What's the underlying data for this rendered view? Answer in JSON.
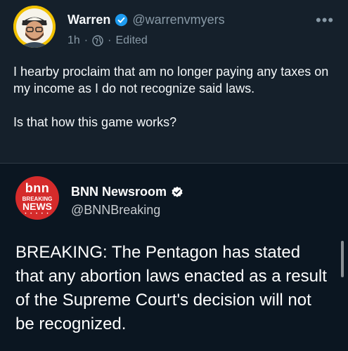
{
  "tweet": {
    "name": "Warren",
    "handle": "@warrenvmyers",
    "time": "1h",
    "separator": "·",
    "edited": "Edited",
    "lines": [
      "I hearby proclaim that am no longer paying any taxes on my income as I do not recognize said laws.",
      "Is that how this game works?"
    ],
    "more": "•••",
    "icons": {
      "avatar": "profile-photo",
      "verified": "verified-badge-icon",
      "audience": "globe-icon",
      "more": "more-options-icon"
    },
    "colors": {
      "verified": "#1d9bf0",
      "avatar_bg": "#f2c200"
    }
  },
  "quoted": {
    "logo": {
      "bnn": "bnn",
      "breaking": "BREAKING",
      "news": "NEWS",
      "dots": "• • • • •"
    },
    "name": "BNN Newsroom",
    "handle": "@BNNBreaking",
    "text": "BREAKING: The Pentagon has stated that any abortion laws enacted as a result of the Supreme Court's decision will not be recognized.",
    "icons": {
      "badge": "verified-badge-icon",
      "scrollbar": "scrollbar-thumb"
    },
    "colors": {
      "logo_bg": "#d52b2b",
      "badge": "#ffffff"
    }
  }
}
